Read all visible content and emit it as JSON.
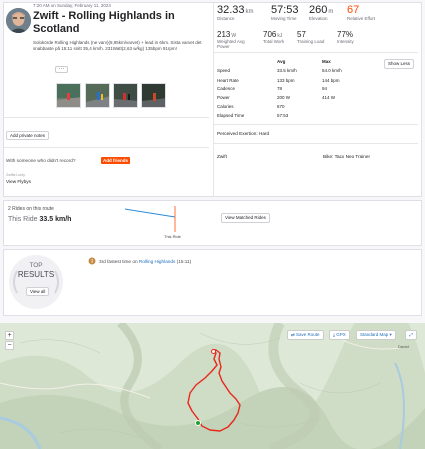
{
  "activity": {
    "date": "7:20 AM on Sunday, February 11, 2024",
    "title": "Zwift - Rolling Highlands in Scotland",
    "description": "Solokörde Rolling Highlands (ne varv)(8,95km/varvet) + lead in 6km. Sista varvet det snabbaste på 15:11 snitt 35,4 km/h. 231Watt(2,63 w/kg) 135bpm 91rpm!",
    "more_label": "···",
    "private_notes_label": "Add private notes",
    "others_prompt": "With someone who didn't record?",
    "add_friends_label": "Add friends",
    "flyby_small": "Zwifts Lonly",
    "view_flybys": "View Flybys"
  },
  "stats": {
    "distance": {
      "value": "32.33",
      "unit": "km",
      "label": "Distance"
    },
    "moving_time": {
      "value": "57:53",
      "label": "Moving Time"
    },
    "elevation": {
      "value": "260",
      "unit": "m",
      "label": "Elevation"
    },
    "relative_effort": {
      "value": "67",
      "label": "Relative Effort",
      "color": "#fc4c02"
    },
    "weighted_power": {
      "value": "213",
      "unit": "W",
      "label": "Weighted Avg Power"
    },
    "total_work": {
      "value": "706",
      "unit": "kJ",
      "label": "Total Work"
    },
    "training_load": {
      "value": "57",
      "label": "Training Load"
    },
    "intensity": {
      "value": "77%",
      "label": "Intensity"
    }
  },
  "details": {
    "avg_header": "Avg",
    "max_header": "Max",
    "show_less": "Show Less",
    "rows": [
      {
        "label": "Speed",
        "avg": "33.5 km/h",
        "max": "54.0 km/h"
      },
      {
        "label": "Heart Rate",
        "avg": "133 bpm",
        "max": "144 bpm"
      },
      {
        "label": "Cadence",
        "avg": "78",
        "max": "94"
      },
      {
        "label": "Power",
        "avg": "200 W",
        "max": "414 W"
      },
      {
        "label": "Calories",
        "avg": "670",
        "max": ""
      },
      {
        "label": "Elapsed Time",
        "avg": "57:53",
        "max": ""
      }
    ],
    "perceived_exertion": "Perceived Exertion: Hard",
    "device": "Zwift",
    "bike": "Bike: Tacx Neo Trainer"
  },
  "rides": {
    "header": "2 Rides on this route",
    "this_ride_label": "This Ride",
    "this_ride_value": "33.5 km/h",
    "marker_label": "This Ride",
    "button": "View Matched Rides"
  },
  "results": {
    "badge_line1": "TOP",
    "badge_line2": "RESULTS",
    "view_all": "View all",
    "achievement_prefix": "3rd fastest time on",
    "segment": "Rolling Highlands",
    "segment_time": "(15:11)"
  },
  "map": {
    "save_route": "Save Route",
    "gpx": "GPX",
    "map_type": "Standard Map",
    "place_label": "Daviot",
    "route_color": "#e8281d",
    "start_color": "#1fa02e",
    "zoom_in": "+",
    "zoom_out": "−"
  }
}
